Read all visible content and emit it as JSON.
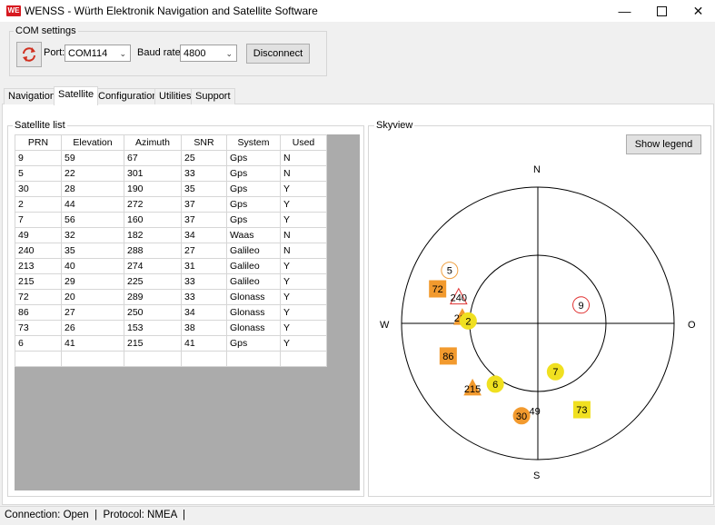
{
  "window": {
    "logo": "WE",
    "title": "WENSS - Würth Elektronik Navigation and Satellite Software",
    "minimize_icon": "minimize-icon",
    "maximize_icon": "maximize-icon",
    "close_icon": "close-icon"
  },
  "com_settings": {
    "title": "COM settings",
    "refresh_icon": "refresh-icon",
    "port_label": "Port:",
    "port_value": "COM114",
    "baud_label": "Baud rate:",
    "baud_value": "4800",
    "disconnect_label": "Disconnect"
  },
  "tabs": [
    {
      "label": "Navigation",
      "active": false
    },
    {
      "label": "Satellite",
      "active": true
    },
    {
      "label": "Configuration",
      "active": false
    },
    {
      "label": "Utilities",
      "active": false
    },
    {
      "label": "Support",
      "active": false
    }
  ],
  "satellite_list": {
    "title": "Satellite list",
    "columns": [
      "PRN",
      "Elevation",
      "Azimuth",
      "SNR",
      "System",
      "Used"
    ],
    "rows": [
      [
        "9",
        "59",
        "67",
        "25",
        "Gps",
        "N"
      ],
      [
        "5",
        "22",
        "301",
        "33",
        "Gps",
        "N"
      ],
      [
        "30",
        "28",
        "190",
        "35",
        "Gps",
        "Y"
      ],
      [
        "2",
        "44",
        "272",
        "37",
        "Gps",
        "Y"
      ],
      [
        "7",
        "56",
        "160",
        "37",
        "Gps",
        "Y"
      ],
      [
        "49",
        "32",
        "182",
        "34",
        "Waas",
        "N"
      ],
      [
        "240",
        "35",
        "288",
        "27",
        "Galileo",
        "N"
      ],
      [
        "213",
        "40",
        "274",
        "31",
        "Galileo",
        "Y"
      ],
      [
        "215",
        "29",
        "225",
        "33",
        "Galileo",
        "Y"
      ],
      [
        "72",
        "20",
        "289",
        "33",
        "Glonass",
        "Y"
      ],
      [
        "86",
        "27",
        "250",
        "34",
        "Glonass",
        "Y"
      ],
      [
        "73",
        "26",
        "153",
        "38",
        "Glonass",
        "Y"
      ],
      [
        "6",
        "41",
        "215",
        "41",
        "Gps",
        "Y"
      ],
      [
        "",
        "",
        "",
        "",
        "",
        ""
      ]
    ]
  },
  "skyview": {
    "title": "Skyview",
    "legend_button": "Show legend",
    "compass": {
      "north": "N",
      "south": "S",
      "west": "W",
      "east": "O"
    },
    "satellites": [
      {
        "id": "5",
        "shape": "circle",
        "style": "outline",
        "color": "#f0a040"
      },
      {
        "id": "72",
        "shape": "square",
        "style": "fill",
        "color": "#f29a2e"
      },
      {
        "id": "240",
        "shape": "triangle",
        "style": "outline",
        "color": "#e03030"
      },
      {
        "id": "213",
        "shape": "triangle",
        "style": "fill",
        "color": "#f29a2e"
      },
      {
        "id": "2",
        "shape": "circle",
        "style": "fill",
        "color": "#f0e020"
      },
      {
        "id": "9",
        "shape": "circle",
        "style": "outline",
        "color": "#e03030"
      },
      {
        "id": "86",
        "shape": "square",
        "style": "fill",
        "color": "#f29a2e"
      },
      {
        "id": "7",
        "shape": "circle",
        "style": "fill",
        "color": "#f0e020"
      },
      {
        "id": "6",
        "shape": "circle",
        "style": "fill",
        "color": "#f0e020"
      },
      {
        "id": "215",
        "shape": "triangle",
        "style": "fill",
        "color": "#f29a2e"
      },
      {
        "id": "30",
        "shape": "circle",
        "style": "fill",
        "color": "#f29a2e"
      },
      {
        "id": "49",
        "shape": "text",
        "style": "plain",
        "color": "#000000"
      },
      {
        "id": "73",
        "shape": "square",
        "style": "fill",
        "color": "#f0e020"
      }
    ]
  },
  "status": {
    "text": "Connection: Open  |  Protocol: NMEA  |"
  }
}
